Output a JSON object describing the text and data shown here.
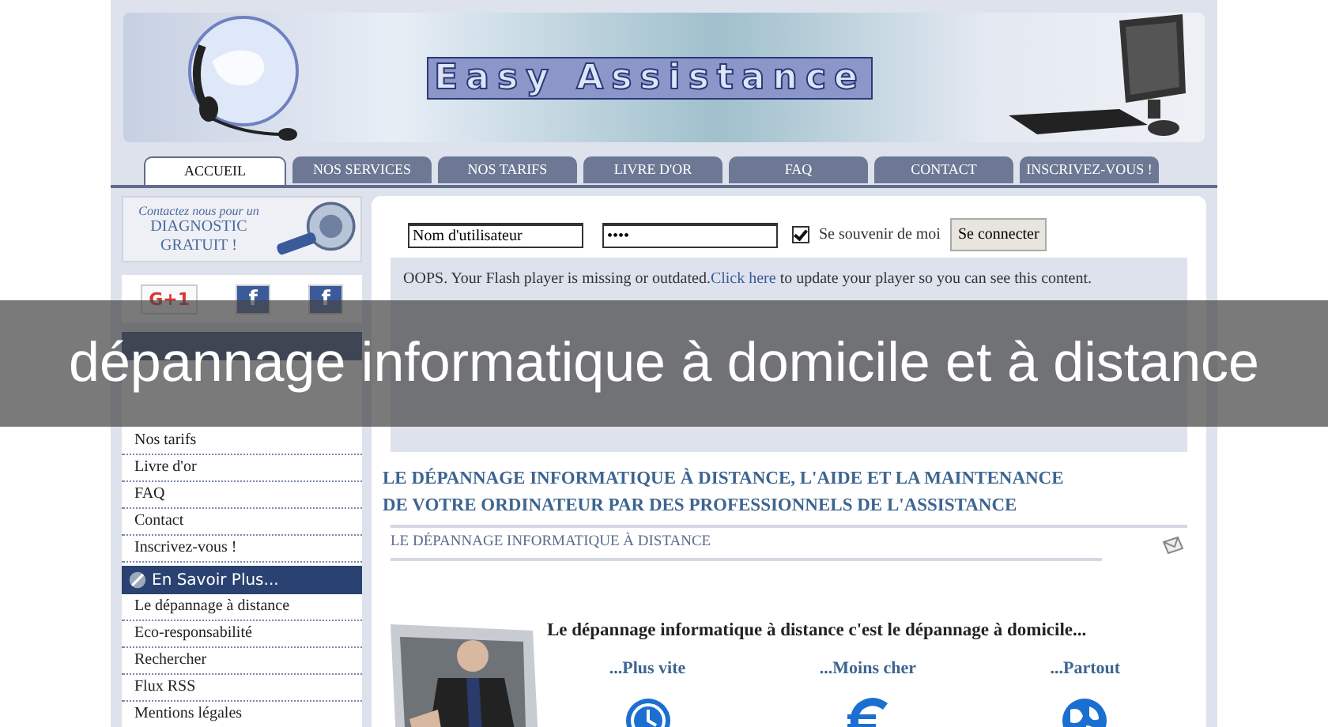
{
  "header": {
    "logo": "Easy Assistance"
  },
  "tabs": [
    {
      "label": "ACCUEIL",
      "selected": true
    },
    {
      "label": "NOS SERVICES",
      "selected": false
    },
    {
      "label": "NOS TARIFS",
      "selected": false
    },
    {
      "label": "LIVRE D'OR",
      "selected": false
    },
    {
      "label": "FAQ",
      "selected": false
    },
    {
      "label": "CONTACT",
      "selected": false
    },
    {
      "label": "INSCRIVEZ-VOUS !",
      "selected": false
    }
  ],
  "sidebar": {
    "promo": {
      "line1": "Contactez nous pour un",
      "line2": "DIAGNOSTIC",
      "line3": "GRATUIT !"
    },
    "social": [
      {
        "kind": "gplus",
        "label": "G+1"
      },
      {
        "kind": "facebook",
        "label": "f"
      },
      {
        "kind": "facebook",
        "label": "f"
      }
    ],
    "sections": [
      {
        "items": [
          "Nos tarifs",
          "Livre d'or",
          "FAQ",
          "Contact",
          "Inscrivez-vous !"
        ]
      },
      {
        "title": "En Savoir Plus...",
        "items": [
          "Le dépannage à distance",
          "Eco-responsabilité",
          "Rechercher",
          "Flux RSS",
          "Mentions légales"
        ]
      }
    ]
  },
  "login": {
    "username": "Nom d'utilisateur",
    "password": "••••",
    "remember": {
      "label": "Se souvenir de moi",
      "checked": true
    },
    "button": "Se connecter"
  },
  "flash": {
    "before": "OOPS. Your Flash player is missing or outdated.",
    "link": "Click here",
    "after": " to update your player so you can see this content."
  },
  "heading": "LE DÉPANNAGE INFORMATIQUE À DISTANCE, L'AIDE ET LA MAINTENANCE DE VOTRE ORDINATEUR PAR DES PROFESSIONNELS DE L'ASSISTANCE",
  "subheading": "LE DÉPANNAGE INFORMATIQUE À DISTANCE",
  "intro": "Le dépannage informatique à distance c'est le dépannage à domicile...",
  "features": [
    {
      "label": "...Plus vite",
      "kind": "clock"
    },
    {
      "label": "...Moins cher",
      "kind": "euro"
    },
    {
      "label": "...Partout",
      "kind": "globe"
    }
  ],
  "caption": "dépannage informatique à domicile et à distance"
}
